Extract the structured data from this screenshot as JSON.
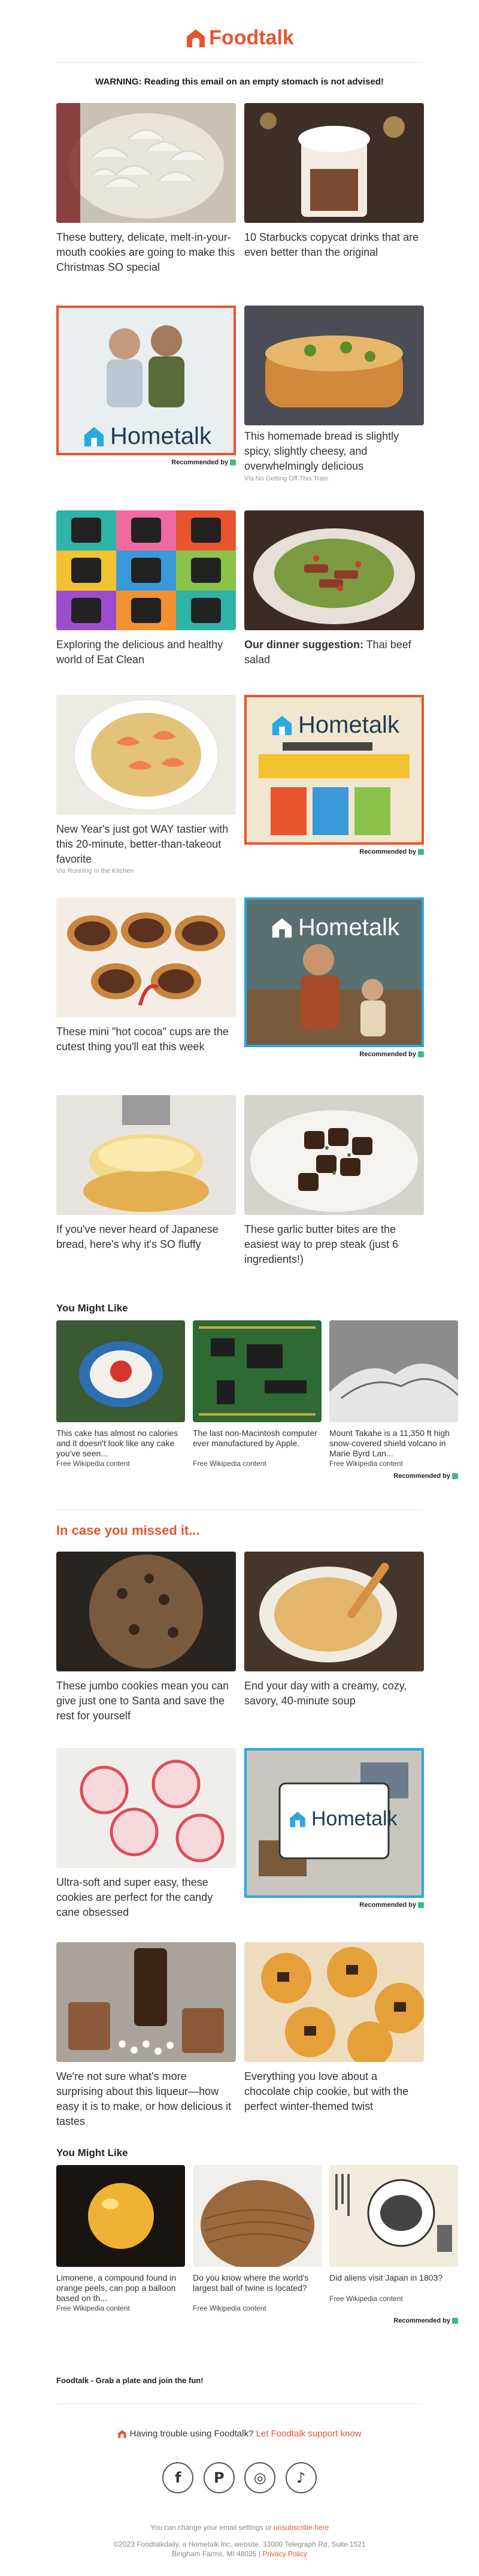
{
  "brand": {
    "name": "Foodtalk",
    "color": "#e8542e"
  },
  "warning": "WARNING: Reading this email on an empty stomach is not advised!",
  "cards": [
    {
      "caption": "These buttery, delicate, melt-in-your-mouth cookies are going to make this Christmas SO special"
    },
    {
      "caption": "10 Starbucks copycat drinks that are even better than the original"
    },
    {
      "ad": "Hometalk",
      "rec": "Recommended by"
    },
    {
      "caption": "This homemade bread is slightly spicy, slightly cheesy, and overwhelmingly delicious",
      "via": "Via No Getting Off This Train"
    },
    {
      "caption": "Exploring the delicious and healthy world of Eat Clean"
    },
    {
      "caption_bold": "Our dinner suggestion:",
      "caption": " Thai beef salad"
    },
    {
      "caption": "New Year's just got WAY tastier with this 20-minute, better-than-takeout favorite",
      "via": "Via Running in the Kitchen"
    },
    {
      "ad": "Hometalk",
      "rec": "Recommended by"
    },
    {
      "caption": "These mini \"hot cocoa\" cups are the cutest thing you'll eat this week"
    },
    {
      "ad": "Hometalk",
      "rec": "Recommended by"
    },
    {
      "caption": "If you've never heard of Japanese bread, here's why it's SO fluffy"
    },
    {
      "caption": "These garlic butter bites are the easiest way to prep steak (just 6 ingredients!)"
    }
  ],
  "you_might_like_1": {
    "title": "You Might Like",
    "items": [
      {
        "caption": "This cake has almost no calories and it doesn't look like any cake you've seen...",
        "source": "Free Wikipedia content"
      },
      {
        "caption": "The last non-Macintosh computer ever manufactured by Apple.",
        "source": "Free Wikipedia content"
      },
      {
        "caption": "Mount Takahe is a 11,350 ft high snow-covered shield volcano in Marie Byrd Lan...",
        "source": "Free Wikipedia content"
      }
    ],
    "rec": "Recommended by"
  },
  "missed": {
    "title": "In case you missed it...",
    "cards": [
      {
        "caption": "These jumbo cookies mean you can give just one to Santa and save the rest for yourself"
      },
      {
        "caption": "End your day with a creamy, cozy, savory, 40-minute soup"
      },
      {
        "caption": "Ultra-soft and super easy, these cookies are perfect for the candy cane obsessed"
      },
      {
        "ad": "Hometalk",
        "rec": "Recommended by"
      },
      {
        "caption": "We're not sure what's more surprising about this liqueur—how easy it is to make, or how delicious it tastes"
      },
      {
        "caption": "Everything you love about a chocolate chip cookie, but with the perfect winter-themed twist"
      }
    ]
  },
  "you_might_like_2": {
    "title": "You Might Like",
    "items": [
      {
        "caption": "Limonene, a compound found in orange peels, can pop a balloon based on th...",
        "source": "Free Wikipedia content"
      },
      {
        "caption": "Do you know where the world's largest ball of twine is located?",
        "source": "Free Wikipedia content"
      },
      {
        "caption": "Did aliens visit Japan in 1803?",
        "source": "Free Wikipedia content"
      }
    ],
    "rec": "Recommended by"
  },
  "footer": {
    "tagline": "Foodtalk - Grab a plate and join the fun!",
    "help_text": "Having trouble using Foodtalk?",
    "help_link": "Let Foodtalk support know",
    "social": [
      "f",
      "P",
      "◎",
      "♪"
    ],
    "settings_text": "You can change your email settings or",
    "unsubscribe": "unsubscribe here",
    "company": "©2023 Foodtalkdaily, a Hometalk Inc. website. 33000 Telegraph Rd, Suite 1521",
    "address": "Bingham Farms, MI 48025",
    "privacy": "Privacy Policy"
  }
}
